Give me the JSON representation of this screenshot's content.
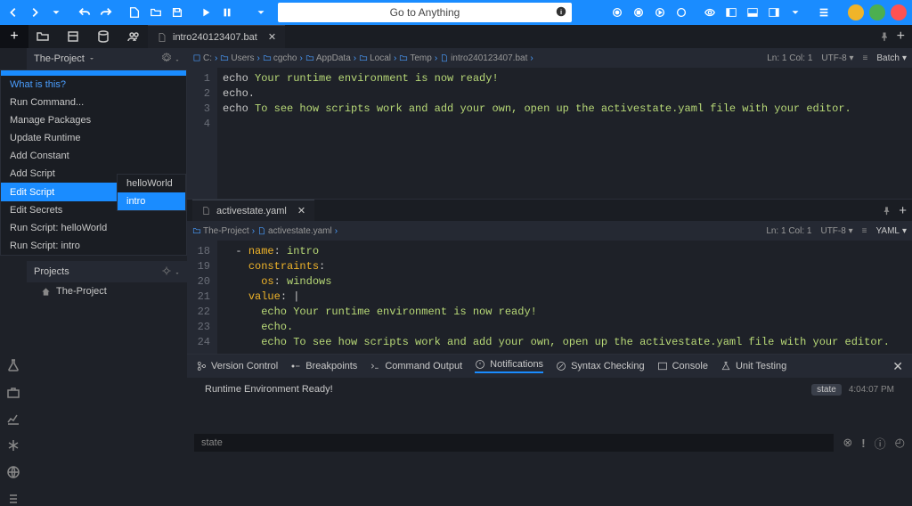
{
  "window": {
    "goto_placeholder": "Go to Anything",
    "btn_min": "minimize",
    "btn_max": "maximize",
    "btn_close": "close"
  },
  "tabs": {
    "file1": "intro240123407.bat",
    "file2": "activestate.yaml"
  },
  "sidebar": {
    "project": "The-Project",
    "context": {
      "what": "What is this?",
      "run_command": "Run Command...",
      "manage_pkgs": "Manage Packages",
      "update_runtime": "Update Runtime",
      "add_constant": "Add Constant",
      "add_script": "Add Script",
      "edit_script": "Edit Script",
      "edit_secrets": "Edit Secrets",
      "run_hello": "Run Script: helloWorld",
      "run_intro": "Run Script: intro",
      "sub_hello": "helloWorld",
      "sub_intro": "intro"
    },
    "projects_label": "Projects",
    "projects_item": "The-Project"
  },
  "editor1": {
    "crumbs": {
      "c": "C:",
      "users": "Users",
      "cgcho": "cgcho",
      "appdata": "AppData",
      "local": "Local",
      "temp": "Temp",
      "file": "intro240123407.bat"
    },
    "status": {
      "pos": "Ln: 1 Col: 1",
      "enc": "UTF-8",
      "lang": "Batch"
    },
    "lines": {
      "1": "1",
      "2": "2",
      "3": "3",
      "4": "4",
      "l1a": "echo ",
      "l1b": "Your runtime environment is now ready!",
      "l2": "echo.",
      "l3a": "echo ",
      "l3b": "To see how scripts work and add your own, open up the activestate.yaml file with your editor."
    }
  },
  "editor2": {
    "crumbs": {
      "proj": "The-Project",
      "file": "activestate.yaml"
    },
    "status": {
      "pos": "Ln: 1 Col: 1",
      "enc": "UTF-8",
      "lang": "YAML"
    },
    "gutter": {
      "18": "18",
      "19": "19",
      "20": "20",
      "21": "21",
      "22": "22",
      "23": "23",
      "24": "24"
    },
    "lines": {
      "l18a": "  - ",
      "l18b": "name",
      "l18c": ": ",
      "l18d": "intro",
      "l19a": "    ",
      "l19b": "constraints",
      "l19c": ":",
      "l20a": "      ",
      "l20b": "os",
      "l20c": ": ",
      "l20d": "windows",
      "l21a": "    ",
      "l21b": "value",
      "l21c": ": ",
      "l21d": "|",
      "l22": "      echo Your runtime environment is now ready!",
      "l23": "      echo.",
      "l24": "      echo To see how scripts work and add your own, open up the activestate.yaml file with your editor."
    }
  },
  "bottom": {
    "vcs": "Version Control",
    "bp": "Breakpoints",
    "cmd": "Command Output",
    "notif": "Notifications",
    "syntax": "Syntax Checking",
    "console": "Console",
    "unit": "Unit Testing"
  },
  "notification": {
    "text": "Runtime Environment Ready!",
    "badge": "state",
    "time": "4:04:07 PM"
  },
  "command": {
    "value": "state"
  }
}
